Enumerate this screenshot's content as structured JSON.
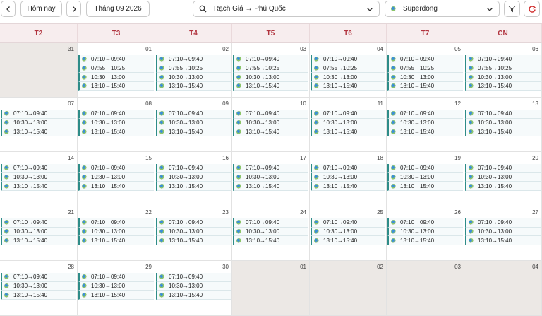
{
  "toolbar": {
    "today_label": "Hôm nay",
    "month_label": "Tháng 09 2026",
    "route_value": "Rạch Giá → Phú Quốc",
    "operator_value": "Superdong",
    "icons": [
      "chevron-left-icon",
      "chevron-right-icon",
      "search-icon",
      "chevron-down-icon",
      "ferry-logo-icon",
      "filter-icon",
      "refresh-icon"
    ],
    "refresh_color": "#d02b2b"
  },
  "weekdays": [
    "T2",
    "T3",
    "T4",
    "T5",
    "T6",
    "T7",
    "CN"
  ],
  "colors": {
    "weekday_text": "#b1343f",
    "header_bg": "#f7edee",
    "other_month_bg": "#ece8e5",
    "trip_accent": "#2e8c88"
  },
  "weeks": [
    [
      {
        "day": "31",
        "other": true,
        "trips": []
      },
      {
        "day": "01",
        "trips": [
          "07:10→09:40",
          "07:55→10:25",
          "10:30→13:00",
          "13:10→15:40"
        ]
      },
      {
        "day": "02",
        "trips": [
          "07:10→09:40",
          "07:55→10:25",
          "10:30→13:00",
          "13:10→15:40"
        ]
      },
      {
        "day": "03",
        "trips": [
          "07:10→09:40",
          "07:55→10:25",
          "10:30→13:00",
          "13:10→15:40"
        ]
      },
      {
        "day": "04",
        "trips": [
          "07:10→09:40",
          "07:55→10:25",
          "10:30→13:00",
          "13:10→15:40"
        ]
      },
      {
        "day": "05",
        "trips": [
          "07:10→09:40",
          "07:55→10:25",
          "10:30→13:00",
          "13:10→15:40"
        ]
      },
      {
        "day": "06",
        "trips": [
          "07:10→09:40",
          "07:55→10:25",
          "10:30→13:00",
          "13:10→15:40"
        ]
      }
    ],
    [
      {
        "day": "07",
        "trips": [
          "07:10→09:40",
          "10:30→13:00",
          "13:10→15:40"
        ]
      },
      {
        "day": "08",
        "trips": [
          "07:10→09:40",
          "10:30→13:00",
          "13:10→15:40"
        ]
      },
      {
        "day": "09",
        "trips": [
          "07:10→09:40",
          "10:30→13:00",
          "13:10→15:40"
        ]
      },
      {
        "day": "10",
        "trips": [
          "07:10→09:40",
          "10:30→13:00",
          "13:10→15:40"
        ]
      },
      {
        "day": "11",
        "trips": [
          "07:10→09:40",
          "10:30→13:00",
          "13:10→15:40"
        ]
      },
      {
        "day": "12",
        "trips": [
          "07:10→09:40",
          "10:30→13:00",
          "13:10→15:40"
        ]
      },
      {
        "day": "13",
        "trips": [
          "07:10→09:40",
          "10:30→13:00",
          "13:10→15:40"
        ]
      }
    ],
    [
      {
        "day": "14",
        "trips": [
          "07:10→09:40",
          "10:30→13:00",
          "13:10→15:40"
        ]
      },
      {
        "day": "15",
        "trips": [
          "07:10→09:40",
          "10:30→13:00",
          "13:10→15:40"
        ]
      },
      {
        "day": "16",
        "trips": [
          "07:10→09:40",
          "10:30→13:00",
          "13:10→15:40"
        ]
      },
      {
        "day": "17",
        "trips": [
          "07:10→09:40",
          "10:30→13:00",
          "13:10→15:40"
        ]
      },
      {
        "day": "18",
        "trips": [
          "07:10→09:40",
          "10:30→13:00",
          "13:10→15:40"
        ]
      },
      {
        "day": "19",
        "trips": [
          "07:10→09:40",
          "10:30→13:00",
          "13:10→15:40"
        ]
      },
      {
        "day": "20",
        "trips": [
          "07:10→09:40",
          "10:30→13:00",
          "13:10→15:40"
        ]
      }
    ],
    [
      {
        "day": "21",
        "trips": [
          "07:10→09:40",
          "10:30→13:00",
          "13:10→15:40"
        ]
      },
      {
        "day": "22",
        "trips": [
          "07:10→09:40",
          "10:30→13:00",
          "13:10→15:40"
        ]
      },
      {
        "day": "23",
        "trips": [
          "07:10→09:40",
          "10:30→13:00",
          "13:10→15:40"
        ]
      },
      {
        "day": "24",
        "trips": [
          "07:10→09:40",
          "10:30→13:00",
          "13:10→15:40"
        ]
      },
      {
        "day": "25",
        "trips": [
          "07:10→09:40",
          "10:30→13:00",
          "13:10→15:40"
        ]
      },
      {
        "day": "26",
        "trips": [
          "07:10→09:40",
          "10:30→13:00",
          "13:10→15:40"
        ]
      },
      {
        "day": "27",
        "trips": [
          "07:10→09:40",
          "10:30→13:00",
          "13:10→15:40"
        ]
      }
    ],
    [
      {
        "day": "28",
        "trips": [
          "07:10→09:40",
          "10:30→13:00",
          "13:10→15:40"
        ]
      },
      {
        "day": "29",
        "trips": [
          "07:10→09:40",
          "10:30→13:00",
          "13:10→15:40"
        ]
      },
      {
        "day": "30",
        "trips": [
          "07:10→09:40",
          "10:30→13:00",
          "13:10→15:40"
        ]
      },
      {
        "day": "01",
        "other": true,
        "trips": []
      },
      {
        "day": "02",
        "other": true,
        "trips": []
      },
      {
        "day": "03",
        "other": true,
        "trips": []
      },
      {
        "day": "04",
        "other": true,
        "trips": []
      }
    ]
  ]
}
